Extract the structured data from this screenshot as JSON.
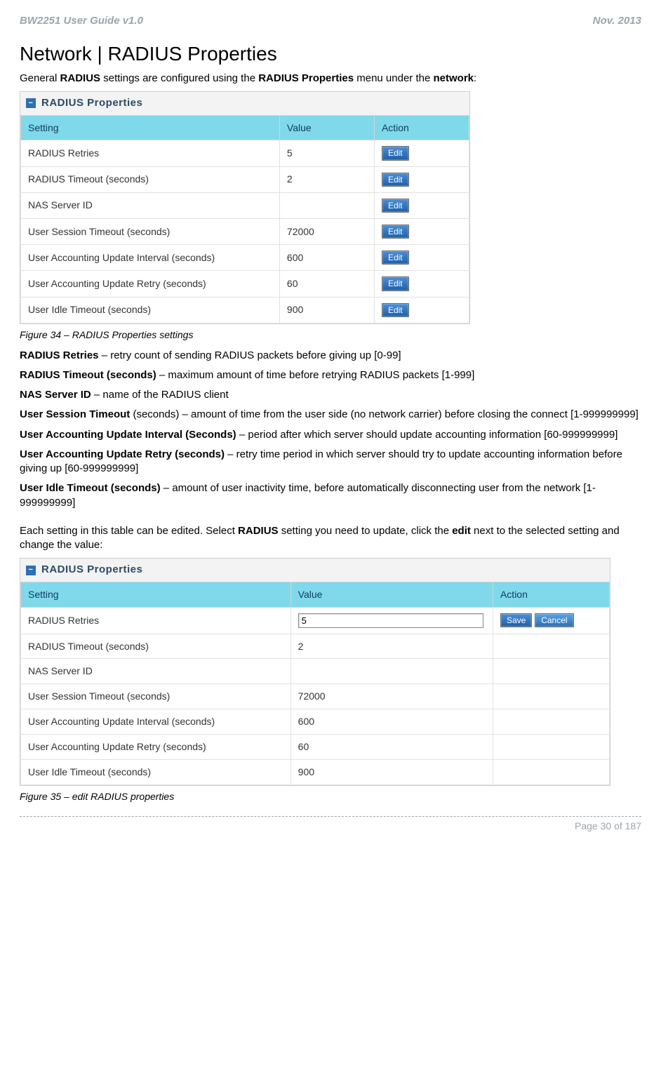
{
  "header": {
    "left": "BW2251 User Guide v1.0",
    "right": "Nov.  2013"
  },
  "section_title": "Network | RADIUS Properties",
  "intro": {
    "pre": "General ",
    "b1": "RADIUS",
    "mid": " settings are configured using the ",
    "b2": "RADIUS Properties",
    "mid2": " menu under the ",
    "b3": "network",
    "tail": ":"
  },
  "panel1": {
    "title": "RADIUS Properties",
    "headers": {
      "setting": "Setting",
      "value": "Value",
      "action": "Action"
    },
    "rows": [
      {
        "setting": "RADIUS Retries",
        "value": "5"
      },
      {
        "setting": "RADIUS Timeout (seconds)",
        "value": "2"
      },
      {
        "setting": "NAS Server ID",
        "value": ""
      },
      {
        "setting": "User Session Timeout (seconds)",
        "value": "72000"
      },
      {
        "setting": "User Accounting Update Interval (seconds)",
        "value": "600"
      },
      {
        "setting": "User Accounting Update Retry (seconds)",
        "value": "60"
      },
      {
        "setting": "User Idle Timeout (seconds)",
        "value": "900"
      }
    ],
    "btn_edit": "Edit"
  },
  "caption1": "Figure 34 – RADIUS Properties settings",
  "defs": [
    {
      "term": "RADIUS Retries",
      "body": " – retry count of sending RADIUS packets before giving up [0-99]"
    },
    {
      "term": "RADIUS Timeout (seconds)",
      "body": " – maximum amount of time before retrying RADIUS packets [1-999]"
    },
    {
      "term": "NAS Server ID",
      "body": " – name of the RADIUS client"
    },
    {
      "term": "User Session Timeout",
      "body": " (seconds) – amount of time from the user side (no network carrier) before closing the connect [1-999999999]"
    },
    {
      "term": "User Accounting Update Interval (Seconds)",
      "body": " – period after which server should update accounting information [60-999999999]"
    },
    {
      "term": "User Accounting Update Retry (seconds)",
      "body": " – retry time period in which server should try to update accounting information before giving up [60-999999999]"
    },
    {
      "term": "User Idle Timeout (seconds)",
      "body": " – amount of user inactivity time, before automatically disconnecting user from the network [1-999999999]"
    }
  ],
  "para2": {
    "a": "Each setting in this table can be edited. Select ",
    "b1": "RADIUS",
    "b": " setting you need to update, click the ",
    "b2": "edit",
    "c": " next to the selected setting and change the value:"
  },
  "panel2": {
    "title": "RADIUS Properties",
    "headers": {
      "setting": "Setting",
      "value": "Value",
      "action": "Action"
    },
    "edit_row": {
      "setting": "RADIUS Retries",
      "value": "5"
    },
    "rows_rest": [
      {
        "setting": "RADIUS Timeout (seconds)",
        "value": "2"
      },
      {
        "setting": "NAS Server ID",
        "value": ""
      },
      {
        "setting": "User Session Timeout (seconds)",
        "value": "72000"
      },
      {
        "setting": "User Accounting Update Interval (seconds)",
        "value": "600"
      },
      {
        "setting": "User Accounting Update Retry (seconds)",
        "value": "60"
      },
      {
        "setting": "User Idle Timeout (seconds)",
        "value": "900"
      }
    ],
    "btn_save": "Save",
    "btn_cancel": "Cancel"
  },
  "caption2": "Figure 35 – edit RADIUS properties",
  "footer": "Page 30 of 187"
}
